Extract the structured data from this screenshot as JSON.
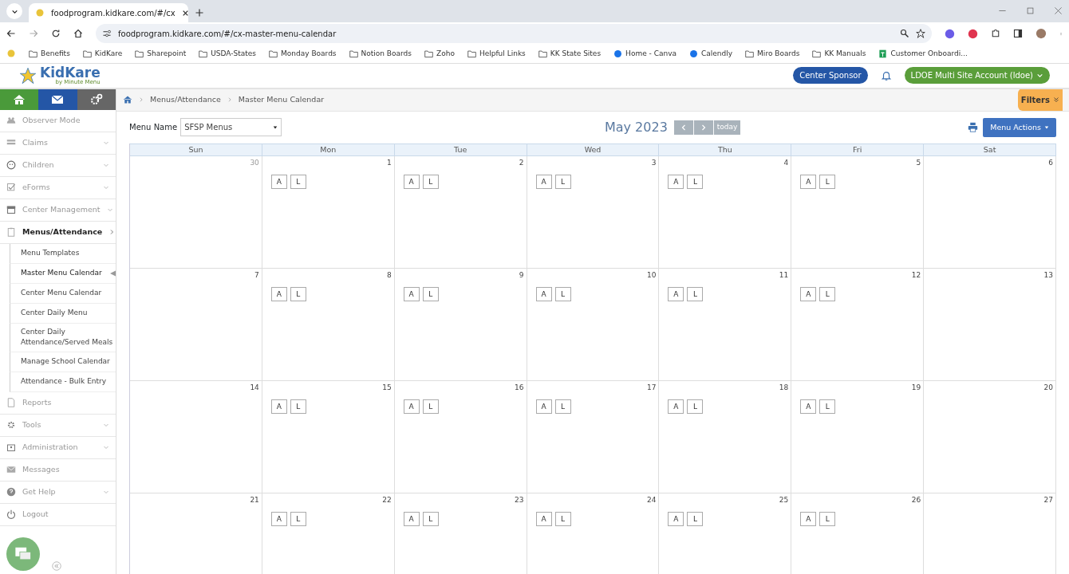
{
  "browser": {
    "tab_title": "foodprogram.kidkare.com/#/cx",
    "url": "foodprogram.kidkare.com/#/cx-master-menu-calendar",
    "bookmarks": [
      {
        "label": "Benefits",
        "kind": "folder"
      },
      {
        "label": "KidKare",
        "kind": "folder"
      },
      {
        "label": "Sharepoint",
        "kind": "folder"
      },
      {
        "label": "USDA-States",
        "kind": "folder"
      },
      {
        "label": "Monday Boards",
        "kind": "folder"
      },
      {
        "label": "Notion Boards",
        "kind": "folder"
      },
      {
        "label": "Zoho",
        "kind": "folder"
      },
      {
        "label": "Helpful Links",
        "kind": "folder"
      },
      {
        "label": "KK State Sites",
        "kind": "folder"
      },
      {
        "label": "Home - Canva",
        "kind": "site"
      },
      {
        "label": "Calendly",
        "kind": "site"
      },
      {
        "label": "Miro Boards",
        "kind": "folder"
      },
      {
        "label": "KK Manuals",
        "kind": "folder"
      },
      {
        "label": "Customer Onboardi...",
        "kind": "sheet"
      }
    ]
  },
  "header": {
    "logo": "KidKare",
    "logo_sub": "by Minute Menu",
    "sponsor_button": "Center Sponsor",
    "account_button": "LDOE Multi Site Account (ldoe)"
  },
  "sidebar": {
    "items": [
      {
        "label": "Observer Mode",
        "kind": "link",
        "selected": false
      },
      {
        "label": "Claims",
        "kind": "menu",
        "expanded": false,
        "selected": false
      },
      {
        "label": "Children",
        "kind": "menu",
        "expanded": false,
        "selected": false
      },
      {
        "label": "eForms",
        "kind": "menu",
        "expanded": false,
        "selected": false
      },
      {
        "label": "Center Management",
        "kind": "menu",
        "expanded": false,
        "selected": false
      },
      {
        "label": "Menus/Attendance",
        "kind": "menu",
        "expanded": true,
        "selected": true,
        "children": [
          {
            "label": "Menu Templates",
            "selected": false
          },
          {
            "label": "Master Menu Calendar",
            "selected": true
          },
          {
            "label": "Center Menu Calendar",
            "selected": false
          },
          {
            "label": "Center Daily Menu",
            "selected": false
          },
          {
            "label": "Center Daily Attendance/Served Meals",
            "selected": false
          },
          {
            "label": "Manage School Calendar",
            "selected": false
          },
          {
            "label": "Attendance - Bulk Entry",
            "selected": false
          }
        ]
      },
      {
        "label": "Reports",
        "kind": "link",
        "selected": false
      },
      {
        "label": "Tools",
        "kind": "menu",
        "expanded": false,
        "selected": false
      },
      {
        "label": "Administration",
        "kind": "menu",
        "expanded": false,
        "selected": false
      },
      {
        "label": "Messages",
        "kind": "link",
        "selected": false
      },
      {
        "label": "Get Help",
        "kind": "menu",
        "expanded": false,
        "selected": false
      },
      {
        "label": "Logout",
        "kind": "link",
        "selected": false
      }
    ]
  },
  "breadcrumb": [
    "Menus/Attendance",
    "Master Menu Calendar"
  ],
  "filters_button": "Filters",
  "menu_name": {
    "label": "Menu Name",
    "value": "SFSP Menus"
  },
  "calendar": {
    "title": "May 2023",
    "today_button": "today",
    "actions_button": "Menu Actions",
    "weekdays": [
      "Sun",
      "Mon",
      "Tue",
      "Wed",
      "Thu",
      "Fri",
      "Sat"
    ],
    "weeks": [
      [
        {
          "number": "30",
          "muted": true
        },
        {
          "number": "1",
          "muted": false,
          "meals": [
            "A",
            "L"
          ]
        },
        {
          "number": "2",
          "muted": false,
          "meals": [
            "A",
            "L"
          ]
        },
        {
          "number": "3",
          "muted": false,
          "meals": [
            "A",
            "L"
          ]
        },
        {
          "number": "4",
          "muted": false,
          "meals": [
            "A",
            "L"
          ]
        },
        {
          "number": "5",
          "muted": false,
          "meals": [
            "A",
            "L"
          ]
        },
        {
          "number": "6",
          "muted": false
        }
      ],
      [
        {
          "number": "7",
          "muted": false
        },
        {
          "number": "8",
          "muted": false,
          "meals": [
            "A",
            "L"
          ]
        },
        {
          "number": "9",
          "muted": false,
          "meals": [
            "A",
            "L"
          ]
        },
        {
          "number": "10",
          "muted": false,
          "meals": [
            "A",
            "L"
          ]
        },
        {
          "number": "11",
          "muted": false,
          "meals": [
            "A",
            "L"
          ]
        },
        {
          "number": "12",
          "muted": false,
          "meals": [
            "A",
            "L"
          ]
        },
        {
          "number": "13",
          "muted": false
        }
      ],
      [
        {
          "number": "14",
          "muted": false
        },
        {
          "number": "15",
          "muted": false,
          "meals": [
            "A",
            "L"
          ]
        },
        {
          "number": "16",
          "muted": false,
          "meals": [
            "A",
            "L"
          ]
        },
        {
          "number": "17",
          "muted": false,
          "meals": [
            "A",
            "L"
          ]
        },
        {
          "number": "18",
          "muted": false,
          "meals": [
            "A",
            "L"
          ]
        },
        {
          "number": "19",
          "muted": false,
          "meals": [
            "A",
            "L"
          ]
        },
        {
          "number": "20",
          "muted": false
        }
      ],
      [
        {
          "number": "21",
          "muted": false
        },
        {
          "number": "22",
          "muted": false,
          "meals": [
            "A",
            "L"
          ]
        },
        {
          "number": "23",
          "muted": false,
          "meals": [
            "A",
            "L"
          ]
        },
        {
          "number": "24",
          "muted": false,
          "meals": [
            "A",
            "L"
          ]
        },
        {
          "number": "25",
          "muted": false,
          "meals": [
            "A",
            "L"
          ]
        },
        {
          "number": "26",
          "muted": false,
          "meals": [
            "A",
            "L"
          ]
        },
        {
          "number": "27",
          "muted": false
        }
      ]
    ]
  }
}
